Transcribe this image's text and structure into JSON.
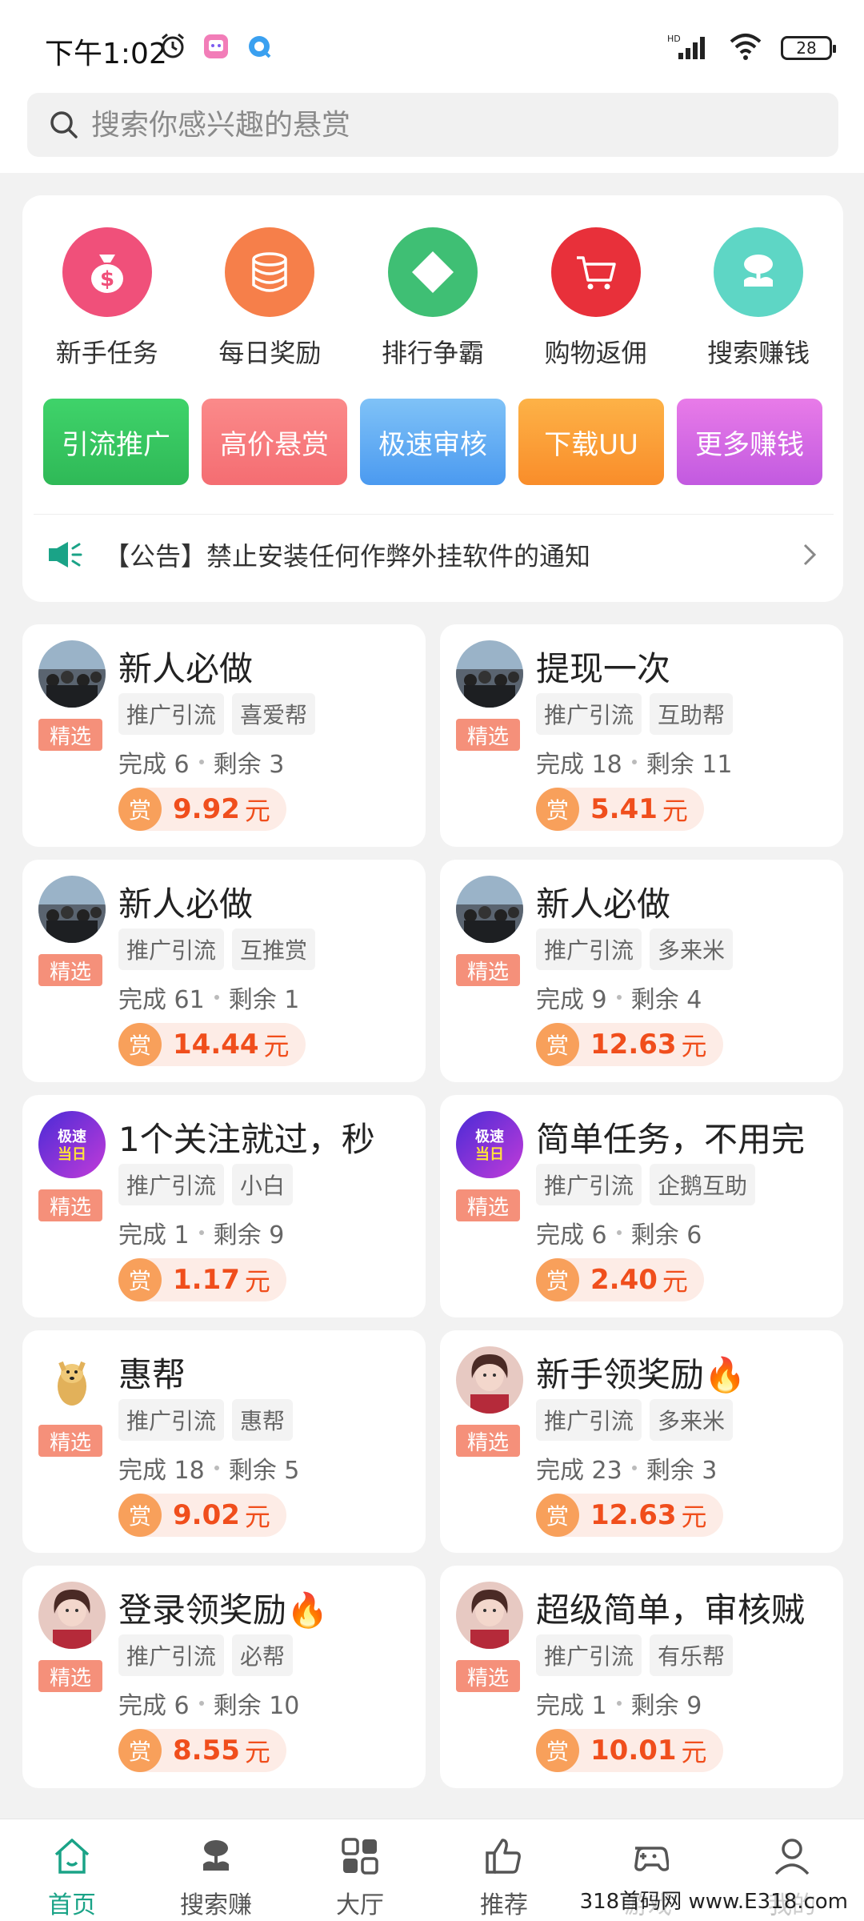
{
  "status_bar": {
    "time": "下午1:02",
    "battery": "28",
    "network": "HD"
  },
  "search": {
    "placeholder": "搜索你感兴趣的悬赏"
  },
  "categories": [
    {
      "label": "新手任务",
      "icon": "money-bag-icon",
      "color": "#f0507a"
    },
    {
      "label": "每日奖励",
      "icon": "coins-stack-icon",
      "color": "#f67f4a"
    },
    {
      "label": "排行争霸",
      "icon": "diamond-icon",
      "color": "#3fbf74"
    },
    {
      "label": "购物返佣",
      "icon": "shopping-cart-icon",
      "color": "#e8303a"
    },
    {
      "label": "搜索赚钱",
      "icon": "sprout-icon",
      "color": "#5ed6c5"
    }
  ],
  "chips": [
    {
      "label": "引流推广",
      "color_from": "#3fd36a",
      "color_to": "#2fb957"
    },
    {
      "label": "高价悬赏",
      "color_from": "#fb8a8a",
      "color_to": "#f46d72"
    },
    {
      "label": "极速审核",
      "color_from": "#7fc2f7",
      "color_to": "#4b9af0"
    },
    {
      "label": "下载UU",
      "color_from": "#fdb247",
      "color_to": "#f98d2a"
    },
    {
      "label": "更多赚钱",
      "color_from": "#e87be8",
      "color_to": "#c25ae0"
    }
  ],
  "notice": {
    "text": "【公告】禁止安装任何作弊外挂软件的通知"
  },
  "badge_label": "精选",
  "reward_label": "赏",
  "reward_unit": "元",
  "stats_done_label": "完成",
  "stats_left_label": "剩余",
  "tasks": [
    {
      "title": "新人必做",
      "tags": [
        "推广引流",
        "喜爱帮"
      ],
      "done": "6",
      "left": "3",
      "reward": "9.92",
      "avatar": "crowd"
    },
    {
      "title": "提现一次",
      "tags": [
        "推广引流",
        "互助帮"
      ],
      "done": "18",
      "left": "11",
      "reward": "5.41",
      "avatar": "crowd"
    },
    {
      "title": "新人必做",
      "tags": [
        "推广引流",
        "互推赏"
      ],
      "done": "61",
      "left": "1",
      "reward": "14.44",
      "avatar": "crowd"
    },
    {
      "title": "新人必做",
      "tags": [
        "推广引流",
        "多来米"
      ],
      "done": "9",
      "left": "4",
      "reward": "12.63",
      "avatar": "crowd"
    },
    {
      "title": "1个关注就过，秒",
      "tags": [
        "推广引流",
        "小白"
      ],
      "done": "1",
      "left": "9",
      "reward": "1.17",
      "avatar": "logo"
    },
    {
      "title": "简单任务，不用完",
      "tags": [
        "推广引流",
        "企鹅互助"
      ],
      "done": "6",
      "left": "6",
      "reward": "2.40",
      "avatar": "logo"
    },
    {
      "title": "惠帮",
      "tags": [
        "推广引流",
        "惠帮"
      ],
      "done": "18",
      "left": "5",
      "reward": "9.02",
      "avatar": "dog"
    },
    {
      "title": "新手领奖励🔥",
      "tags": [
        "推广引流",
        "多来米"
      ],
      "done": "23",
      "left": "3",
      "reward": "12.63",
      "avatar": "girl"
    },
    {
      "title": "登录领奖励🔥",
      "tags": [
        "推广引流",
        "必帮"
      ],
      "done": "6",
      "left": "10",
      "reward": "8.55",
      "avatar": "girl"
    },
    {
      "title": "超级简单，审核贼",
      "tags": [
        "推广引流",
        "有乐帮"
      ],
      "done": "1",
      "left": "9",
      "reward": "10.01",
      "avatar": "girl"
    }
  ],
  "nav": [
    {
      "label": "首页",
      "icon": "home-icon",
      "active": true
    },
    {
      "label": "搜索赚",
      "icon": "sprout-icon",
      "active": false
    },
    {
      "label": "大厅",
      "icon": "grid-icon",
      "active": false
    },
    {
      "label": "推荐",
      "icon": "thumbs-up-icon",
      "active": false
    },
    {
      "label": "游戏",
      "icon": "gamepad-icon",
      "active": false
    },
    {
      "label": "我的",
      "icon": "person-icon",
      "active": false
    }
  ],
  "watermark": "318首码网 www.E318.com"
}
